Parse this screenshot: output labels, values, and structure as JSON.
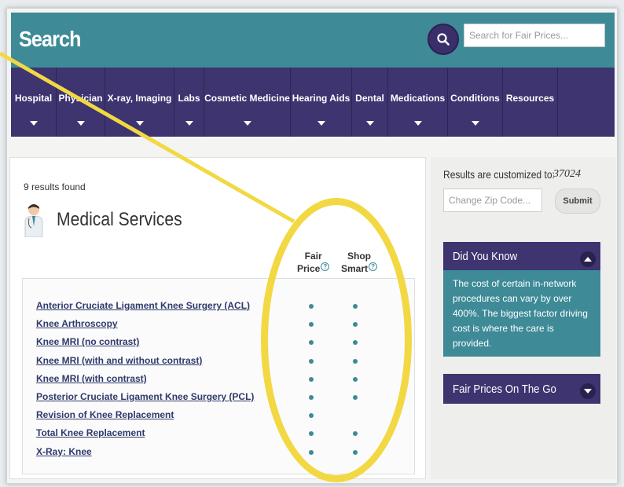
{
  "header": {
    "title": "Search",
    "search_placeholder": "Search for Fair Prices...",
    "search_icon": "search-icon"
  },
  "nav": {
    "items": [
      {
        "label": "Hospital"
      },
      {
        "label": "Physician"
      },
      {
        "label": "X-ray, Imaging"
      },
      {
        "label": "Labs"
      },
      {
        "label": "Cosmetic Medicine"
      },
      {
        "label": "Hearing Aids"
      },
      {
        "label": "Dental"
      },
      {
        "label": "Medications"
      },
      {
        "label": "Conditions"
      },
      {
        "label": "Resources"
      }
    ]
  },
  "results": {
    "count_text": "9 results found",
    "section_title": "Medical Services",
    "col_fair": [
      "Fair",
      "Price"
    ],
    "col_shop": [
      "Shop",
      "Smart"
    ],
    "help_glyph": "?",
    "rows": [
      {
        "name": "Anterior Cruciate Ligament Knee Surgery (ACL)",
        "fair_price": true,
        "shop_smart": true
      },
      {
        "name": "Knee Arthroscopy",
        "fair_price": true,
        "shop_smart": true
      },
      {
        "name": "Knee MRI (no contrast)",
        "fair_price": true,
        "shop_smart": true
      },
      {
        "name": "Knee MRI (with and without contrast)",
        "fair_price": true,
        "shop_smart": true
      },
      {
        "name": "Knee MRI (with contrast)",
        "fair_price": true,
        "shop_smart": true
      },
      {
        "name": "Posterior Cruciate Ligament Knee Surgery (PCL)",
        "fair_price": true,
        "shop_smart": true
      },
      {
        "name": "Revision of Knee Replacement",
        "fair_price": true,
        "shop_smart": false
      },
      {
        "name": "Total Knee Replacement",
        "fair_price": true,
        "shop_smart": true
      },
      {
        "name": "X-Ray: Knee",
        "fair_price": true,
        "shop_smart": true
      }
    ]
  },
  "sidebar": {
    "custom_label": "Results are customized to:",
    "zip_value": "37024",
    "zip_placeholder": "Change Zip Code...",
    "submit_label": "Submit",
    "did_you_know": {
      "title": "Did You Know",
      "body": "The cost of certain in-network procedures can vary by over 400%. The biggest factor driving cost is where the care is provided."
    },
    "fair_prices_go": {
      "title": "Fair Prices On The Go"
    }
  },
  "colors": {
    "teal": "#3e8a97",
    "purple": "#3d3470",
    "highlight_yellow": "#f2d842"
  }
}
